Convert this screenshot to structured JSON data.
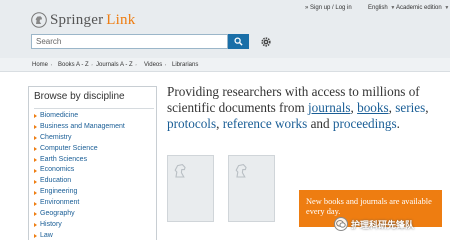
{
  "header": {
    "brand": "Springer",
    "brand_suffix": "Link",
    "signin": "Sign up / Log in",
    "language": "English",
    "edition": "Academic edition",
    "search_placeholder": "Search"
  },
  "nav": {
    "items": [
      "Home",
      "Books A - Z",
      "Journals A - Z",
      "Videos",
      "Librarians"
    ]
  },
  "sidebar": {
    "title": "Browse by discipline",
    "items": [
      "Biomedicine",
      "Business and Management",
      "Chemistry",
      "Computer Science",
      "Earth Sciences",
      "Economics",
      "Education",
      "Engineering",
      "Environment",
      "Geography",
      "History",
      "Law"
    ]
  },
  "tagline": {
    "intro": "Providing researchers with access to millions of scientific documents from",
    "journals": "journals",
    "books": "books",
    "series": "series",
    "protocols": "protocols",
    "reference_works": "reference works",
    "and": "and",
    "proceedings": "proceedings",
    "sep": ",",
    "end": "."
  },
  "promo": {
    "text": "New books and journals are available every day."
  },
  "watermark": {
    "text": "护理科研先锋队"
  },
  "colors": {
    "brand_orange": "#ee7d11",
    "link_blue": "#1a5e96",
    "search_button": "#1a6fa8",
    "header_bg": "#e8ecef"
  }
}
